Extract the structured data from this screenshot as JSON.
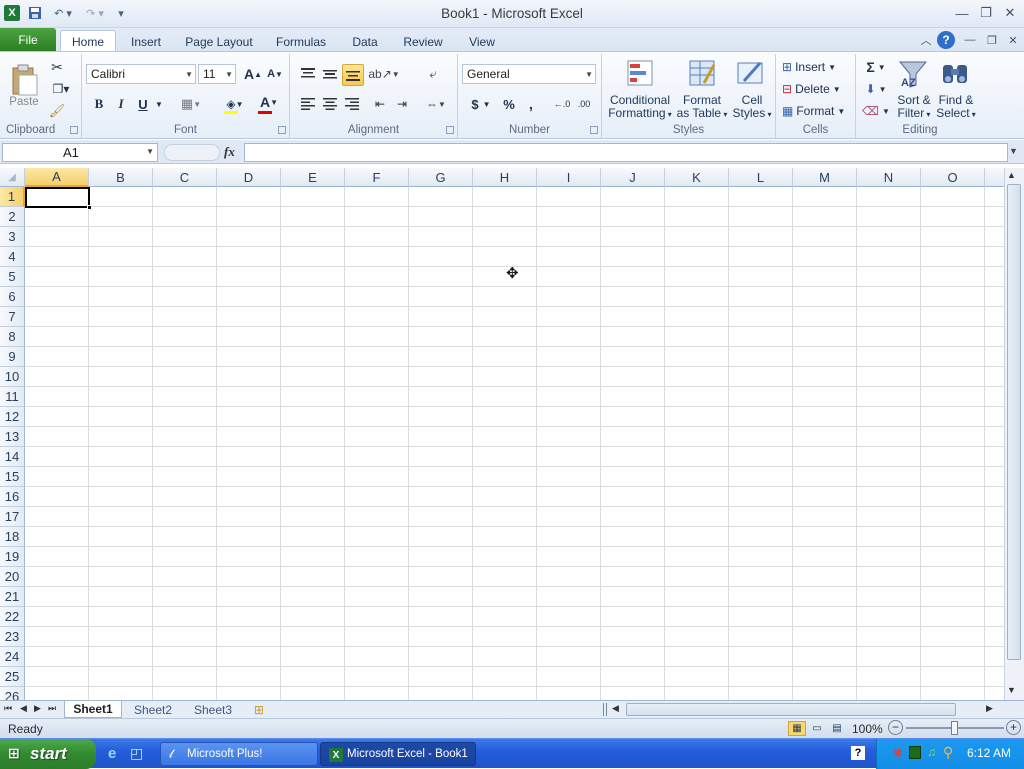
{
  "window": {
    "title": "Book1  -  Microsoft Excel"
  },
  "tabs": [
    "File",
    "Home",
    "Insert",
    "Page Layout",
    "Formulas",
    "Data",
    "Review",
    "View"
  ],
  "ribbon": {
    "clipboard": {
      "paste": "Paste",
      "group": "Clipboard"
    },
    "font": {
      "name": "Calibri",
      "size": "11",
      "bold": "B",
      "italic": "I",
      "underline": "U",
      "grow": "A",
      "shrink": "A",
      "group": "Font"
    },
    "alignment": {
      "group": "Alignment"
    },
    "number": {
      "format": "General",
      "currency": "$",
      "percent": "%",
      "comma": ",",
      "group": "Number"
    },
    "styles": {
      "conditional": "Conditional",
      "conditional2": "Formatting",
      "format_table": "Format",
      "format_table2": "as Table",
      "cell_styles": "Cell",
      "cell_styles2": "Styles",
      "group": "Styles"
    },
    "cells": {
      "insert": "Insert",
      "delete": "Delete",
      "format": "Format",
      "group": "Cells"
    },
    "editing": {
      "sigma": "Σ",
      "sort": "Sort &",
      "sort2": "Filter",
      "find": "Find &",
      "find2": "Select",
      "group": "Editing"
    }
  },
  "formula_bar": {
    "name_box": "A1",
    "fx": "fx",
    "value": ""
  },
  "columns": [
    "A",
    "B",
    "C",
    "D",
    "E",
    "F",
    "G",
    "H",
    "I",
    "J",
    "K",
    "L",
    "M",
    "N",
    "O"
  ],
  "rows": [
    "1",
    "2",
    "3",
    "4",
    "5",
    "6",
    "7",
    "8",
    "9",
    "10",
    "11",
    "12",
    "13",
    "14",
    "15",
    "16",
    "17",
    "18",
    "19",
    "20",
    "21",
    "22",
    "23",
    "24",
    "25",
    "26"
  ],
  "sheets": [
    "Sheet1",
    "Sheet2",
    "Sheet3"
  ],
  "status": {
    "text": "Ready",
    "zoom": "100%"
  },
  "taskbar": {
    "start": "start",
    "items": [
      "Microsoft Plus!",
      "Microsoft Excel - Book1"
    ],
    "clock": "6:12 AM"
  },
  "colors": {
    "accent_green": "#2b7d22",
    "selected_header": "#f9d97a",
    "taskbar_blue": "#245edb"
  }
}
